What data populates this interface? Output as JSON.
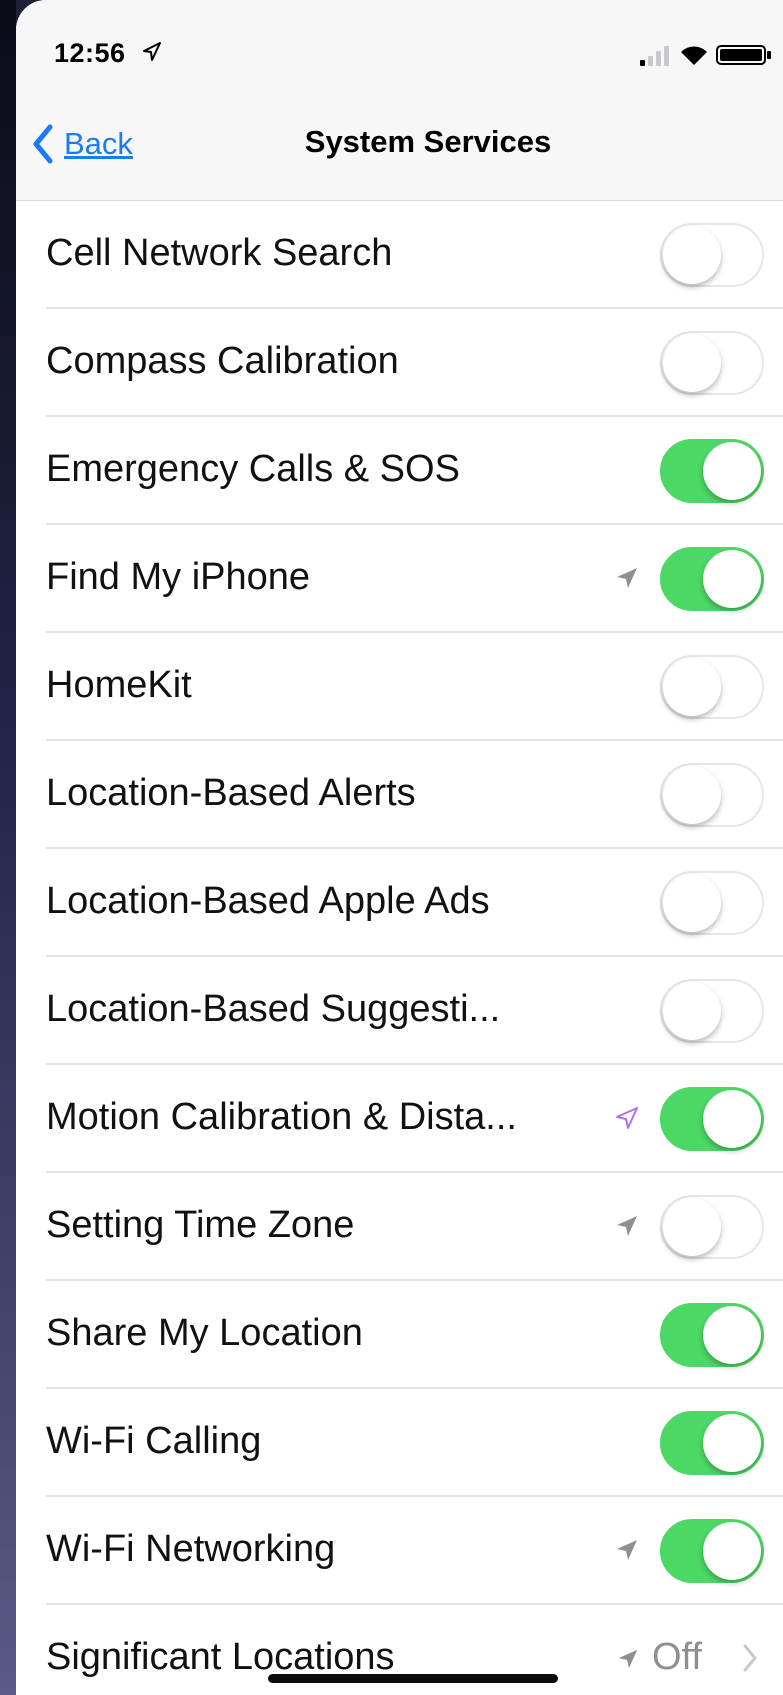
{
  "status_bar": {
    "time": "12:56"
  },
  "nav": {
    "back_label": "Back",
    "title": "System Services"
  },
  "rows": [
    {
      "label": "Cell Network Search",
      "toggle": "off"
    },
    {
      "label": "Compass Calibration",
      "toggle": "off"
    },
    {
      "label": "Emergency Calls & SOS",
      "toggle": "on"
    },
    {
      "label": "Find My iPhone",
      "toggle": "on",
      "location_arrow": "gray"
    },
    {
      "label": "HomeKit",
      "toggle": "off"
    },
    {
      "label": "Location-Based Alerts",
      "toggle": "off"
    },
    {
      "label": "Location-Based Apple Ads",
      "toggle": "off"
    },
    {
      "label": "Location-Based Suggesti...",
      "toggle": "off"
    },
    {
      "label": "Motion Calibration & Dista...",
      "toggle": "on",
      "location_arrow": "purple-outline"
    },
    {
      "label": "Setting Time Zone",
      "toggle": "off",
      "location_arrow": "gray"
    },
    {
      "label": "Share My Location",
      "toggle": "on"
    },
    {
      "label": "Wi-Fi Calling",
      "toggle": "on"
    },
    {
      "label": "Wi-Fi Networking",
      "toggle": "on",
      "location_arrow": "gray"
    }
  ],
  "significant_locations": {
    "label": "Significant Locations",
    "value": "Off",
    "location_arrow": "gray"
  },
  "colors": {
    "toggle_on": "#4cd864",
    "link_blue": "#1a7cf5",
    "location_gray": "#8e8e93",
    "location_purple": "#b36df0"
  }
}
